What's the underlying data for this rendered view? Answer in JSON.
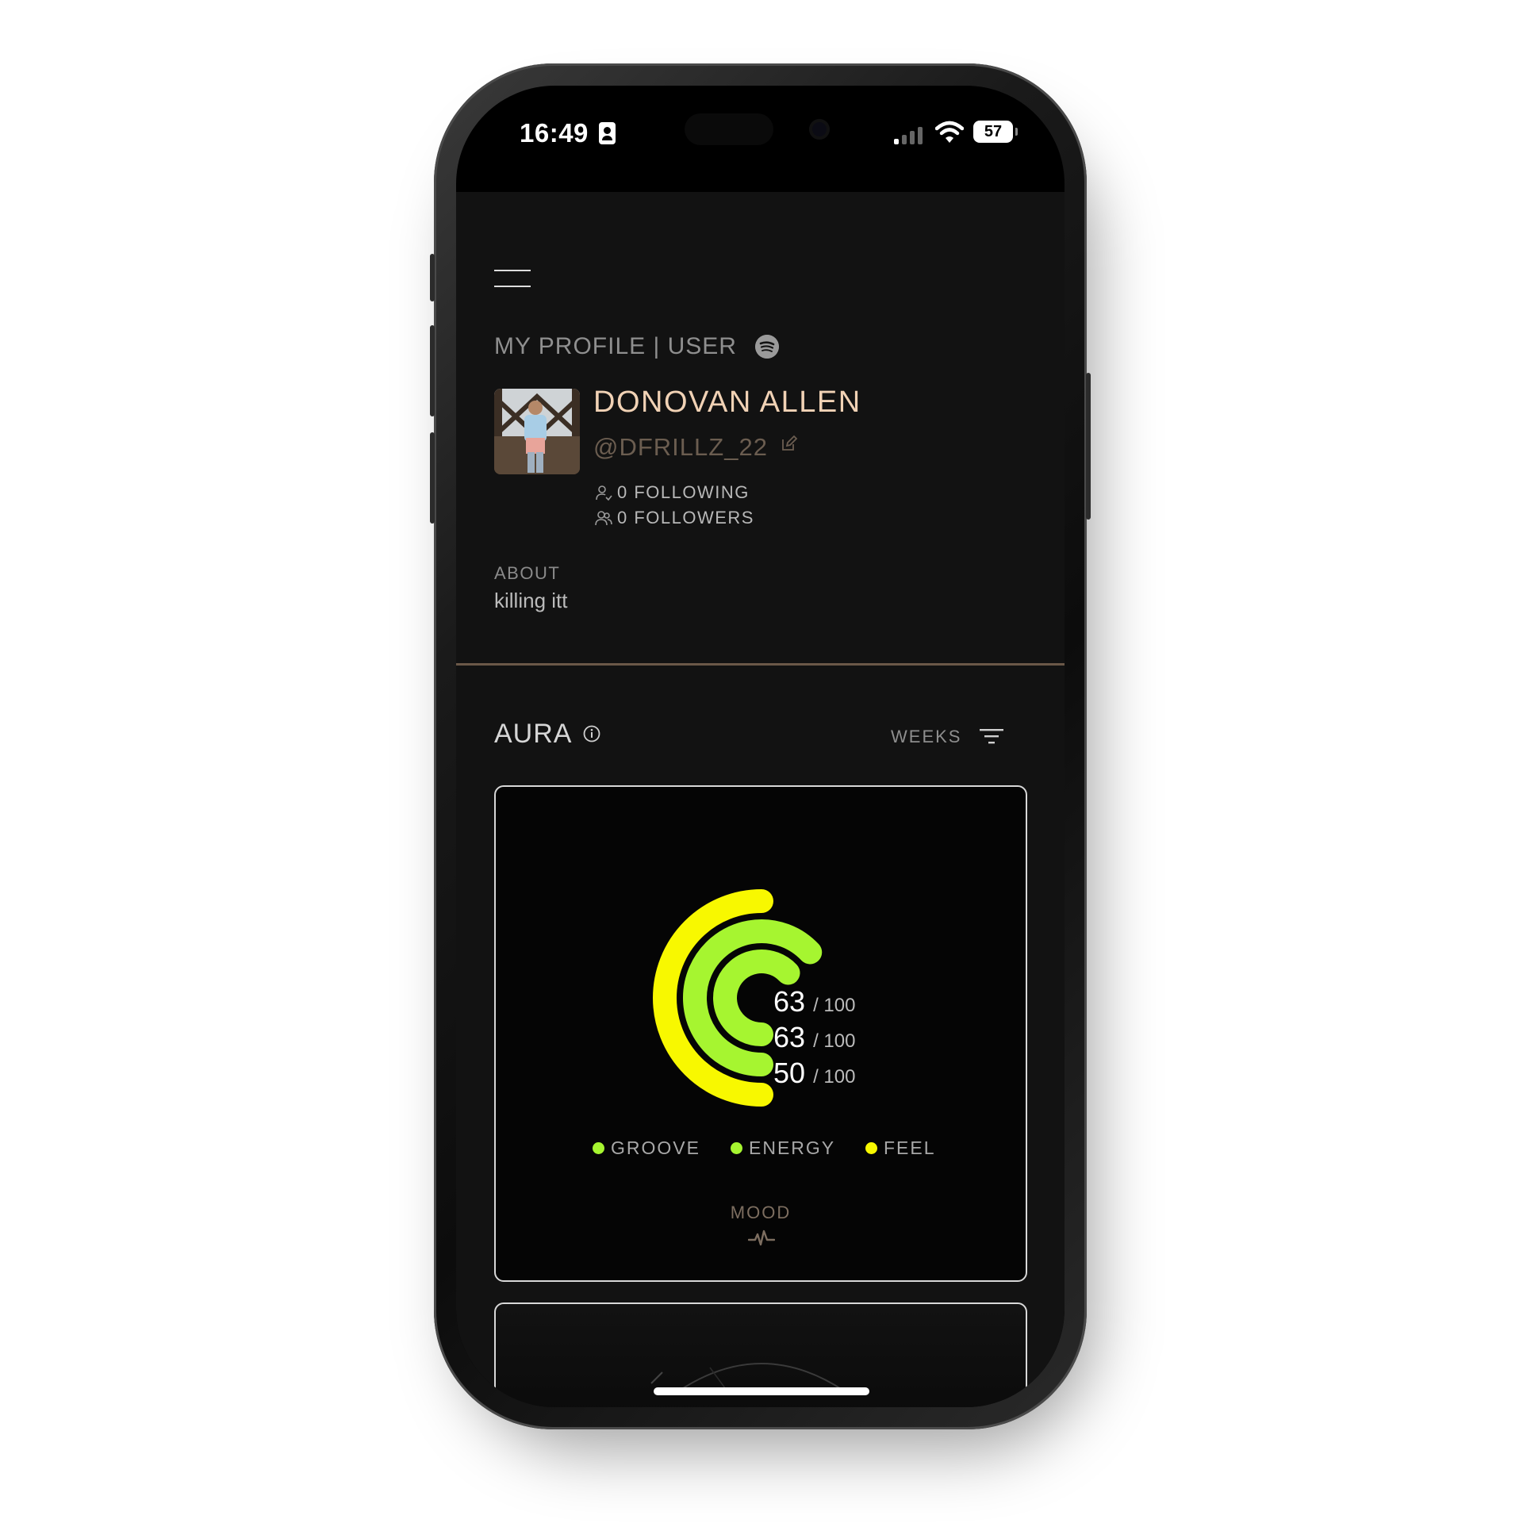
{
  "status_bar": {
    "time": "16:49",
    "battery": "57"
  },
  "header": {
    "title": "MY PROFILE | USER"
  },
  "profile": {
    "name": "DONOVAN ALLEN",
    "handle": "@DFRILLZ_22",
    "following": "0 FOLLOWING",
    "followers": "0 FOLLOWERS",
    "about_label": "ABOUT",
    "about_text": "killing itt"
  },
  "aura": {
    "title": "AURA",
    "period": "WEEKS",
    "mood_label": "MOOD",
    "max_suffix": "/ 100",
    "scores": [
      {
        "value": "63",
        "fraction": 0.63
      },
      {
        "value": "63",
        "fraction": 0.63
      },
      {
        "value": "50",
        "fraction": 0.5
      }
    ],
    "legend": [
      {
        "label": "GROOVE",
        "color": "#a6f530"
      },
      {
        "label": "ENERGY",
        "color": "#a6f530"
      },
      {
        "label": "FEEL",
        "color": "#f8f800"
      }
    ],
    "colors": {
      "inner": "#a6f530",
      "middle": "#a6f530",
      "outer": "#f8f800"
    }
  }
}
